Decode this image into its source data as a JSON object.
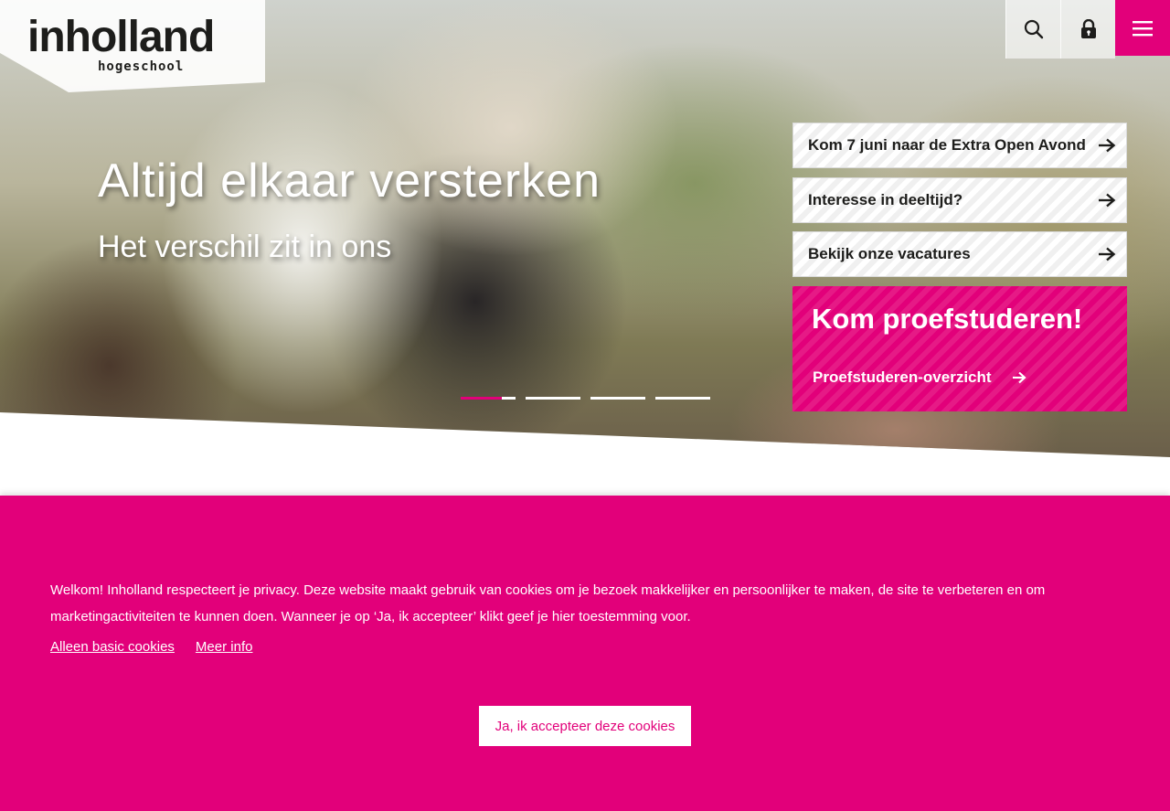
{
  "colors": {
    "brand": "#e2007a",
    "text_dark": "#1d1d1b",
    "white": "#ffffff"
  },
  "header": {
    "logo_text": "inholland",
    "logo_subtext": "hogeschool",
    "icons": {
      "search": "search-icon",
      "account": "lock-icon",
      "menu": "hamburger-menu-icon"
    }
  },
  "hero": {
    "title": "Altijd elkaar versterken",
    "subtitle": "Het verschil zit in ons",
    "slider": {
      "slide_count": 4,
      "active_slide": 1,
      "active_progress": 0.75
    }
  },
  "quick_links": [
    {
      "label": "Kom 7 juni naar de Extra Open Avond",
      "icon": "arrow-right-icon"
    },
    {
      "label": "Interesse in deeltijd?",
      "icon": "arrow-right-icon"
    },
    {
      "label": "Bekijk onze vacatures",
      "icon": "arrow-right-icon"
    }
  ],
  "promo": {
    "title": "Kom proefstuderen!",
    "link_label": "Proefstuderen-overzicht",
    "link_icon": "arrow-right-icon"
  },
  "cookie_banner": {
    "text": "Welkom! Inholland respecteert je privacy. Deze website maakt gebruik van cookies om je bezoek makkelijker en persoonlijker te maken, de site te verbeteren en om marketingactiviteiten te kunnen doen. Wanneer je op ‘Ja, ik accepteer’ klikt geef je hier toestemming voor.",
    "basic_link": "Alleen basic cookies",
    "more_info_link": "Meer info",
    "accept_button": "Ja, ik accepteer deze cookies"
  }
}
